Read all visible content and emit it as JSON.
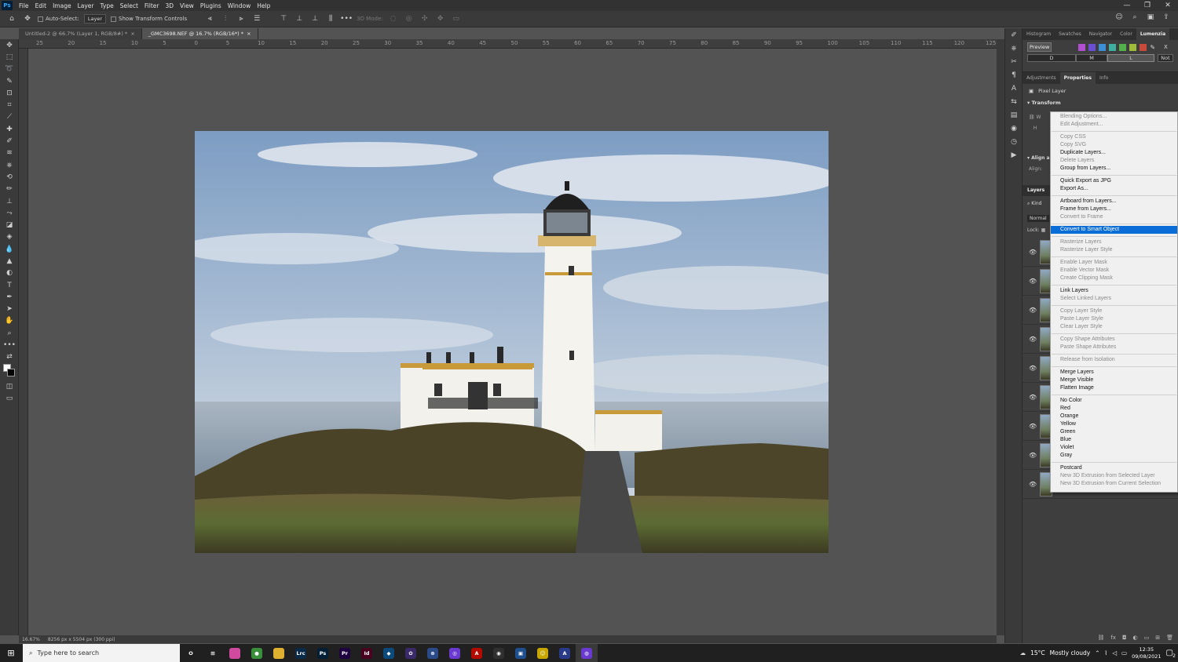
{
  "menubar": {
    "app_icon": "Ps",
    "items": [
      "File",
      "Edit",
      "Image",
      "Layer",
      "Type",
      "Select",
      "Filter",
      "3D",
      "View",
      "Plugins",
      "Window",
      "Help"
    ]
  },
  "options": {
    "auto_select_label": "Auto-Select:",
    "auto_select_value": "Layer",
    "show_transform_label": "Show Transform Controls",
    "mode_3d_label": "3D Mode:"
  },
  "tabs": [
    {
      "label": "Untitled-2 @ 66.7% (Layer 1, RGB/8#) *",
      "close": "×"
    },
    {
      "label": "_GMC3698.NEF @ 16.7% (RGB/16*) *",
      "close": "×"
    }
  ],
  "ruler_ticks": [
    "25",
    "20",
    "15",
    "10",
    "5",
    "0",
    "5",
    "10",
    "15",
    "20",
    "25",
    "30",
    "35",
    "40",
    "45",
    "50",
    "55",
    "60",
    "65",
    "70",
    "75",
    "80",
    "85",
    "90",
    "95",
    "100",
    "105",
    "110",
    "115",
    "120",
    "125"
  ],
  "status": {
    "zoom": "16.67%",
    "doc_info": "8256 px x 5504 px (300 ppi)"
  },
  "panel": {
    "top_tabs": [
      "Histogram",
      "Swatches",
      "Navigator",
      "Color",
      "Lumenzia"
    ],
    "top_active": "Lumenzia",
    "lumenzia": {
      "preview_label": "Preview",
      "x_label": "X",
      "zones": [
        "D",
        "M",
        "L"
      ],
      "not_label": "Not",
      "swatches": [
        "#b04fd2",
        "#6a4fd4",
        "#3b8fd6",
        "#3fb0a0",
        "#54b04a",
        "#9ebb3a",
        "#c84a3a"
      ]
    },
    "prop_tabs": [
      "Adjustments",
      "Properties",
      "Info"
    ],
    "prop_active": "Properties",
    "pixel_layer_label": "Pixel Layer",
    "transform_label": "Transform",
    "w_label": "W",
    "h_label": "H",
    "align_label": "Align a",
    "align_sub": "Align:",
    "layers_tab": "Layers",
    "kind_label": "Kind",
    "blend_label": "Normal",
    "lock_label": "Lock:",
    "layer_rows": 9
  },
  "context_menu": {
    "groups": [
      [
        {
          "label": "Blending Options...",
          "enabled": false
        },
        {
          "label": "Edit Adjustment...",
          "enabled": false
        }
      ],
      [
        {
          "label": "Copy CSS",
          "enabled": false
        },
        {
          "label": "Copy SVG",
          "enabled": false
        },
        {
          "label": "Duplicate Layers...",
          "enabled": true
        },
        {
          "label": "Delete Layers",
          "enabled": false
        },
        {
          "label": "Group from Layers...",
          "enabled": true
        }
      ],
      [
        {
          "label": "Quick Export as JPG",
          "enabled": true
        },
        {
          "label": "Export As...",
          "enabled": true
        }
      ],
      [
        {
          "label": "Artboard from Layers...",
          "enabled": true
        },
        {
          "label": "Frame from Layers...",
          "enabled": true
        },
        {
          "label": "Convert to Frame",
          "enabled": false
        }
      ],
      [
        {
          "label": "Convert to Smart Object",
          "enabled": true,
          "highlighted": true
        }
      ],
      [
        {
          "label": "Rasterize Layers",
          "enabled": false
        },
        {
          "label": "Rasterize Layer Style",
          "enabled": false
        }
      ],
      [
        {
          "label": "Enable Layer Mask",
          "enabled": false
        },
        {
          "label": "Enable Vector Mask",
          "enabled": false
        },
        {
          "label": "Create Clipping Mask",
          "enabled": false
        }
      ],
      [
        {
          "label": "Link Layers",
          "enabled": true
        },
        {
          "label": "Select Linked Layers",
          "enabled": false
        }
      ],
      [
        {
          "label": "Copy Layer Style",
          "enabled": false
        },
        {
          "label": "Paste Layer Style",
          "enabled": false
        },
        {
          "label": "Clear Layer Style",
          "enabled": false
        }
      ],
      [
        {
          "label": "Copy Shape Attributes",
          "enabled": false
        },
        {
          "label": "Paste Shape Attributes",
          "enabled": false
        }
      ],
      [
        {
          "label": "Release from Isolation",
          "enabled": false
        }
      ],
      [
        {
          "label": "Merge Layers",
          "enabled": true
        },
        {
          "label": "Merge Visible",
          "enabled": true
        },
        {
          "label": "Flatten Image",
          "enabled": true
        }
      ],
      [
        {
          "label": "No Color",
          "enabled": true
        },
        {
          "label": "Red",
          "enabled": true
        },
        {
          "label": "Orange",
          "enabled": true
        },
        {
          "label": "Yellow",
          "enabled": true
        },
        {
          "label": "Green",
          "enabled": true
        },
        {
          "label": "Blue",
          "enabled": true
        },
        {
          "label": "Violet",
          "enabled": true
        },
        {
          "label": "Gray",
          "enabled": true
        }
      ],
      [
        {
          "label": "Postcard",
          "enabled": true
        },
        {
          "label": "New 3D Extrusion from Selected Layer",
          "enabled": false
        },
        {
          "label": "New 3D Extrusion from Current Selection",
          "enabled": false
        }
      ]
    ]
  },
  "taskbar": {
    "search_placeholder": "Type here to search",
    "apps": [
      {
        "name": "task-view",
        "label": "O",
        "color": "transparent"
      },
      {
        "name": "widgets",
        "label": "⊞",
        "color": "transparent"
      },
      {
        "name": "photos",
        "label": "",
        "color": "#d04aa0"
      },
      {
        "name": "chrome",
        "label": "●",
        "color": "#3a8f3a"
      },
      {
        "name": "explorer",
        "label": "",
        "color": "#e0b030"
      },
      {
        "name": "lightroom-classic",
        "label": "Lrc",
        "color": "#0a2a4a"
      },
      {
        "name": "photoshop",
        "label": "Ps",
        "color": "#001e36"
      },
      {
        "name": "premiere",
        "label": "Pr",
        "color": "#1f0040"
      },
      {
        "name": "indesign",
        "label": "Id",
        "color": "#49021f"
      },
      {
        "name": "app-cube",
        "label": "◆",
        "color": "#0b4a7a"
      },
      {
        "name": "app-swirl",
        "label": "✿",
        "color": "#3a2a6a"
      },
      {
        "name": "app-globe",
        "label": "⊛",
        "color": "#2a4a8a"
      },
      {
        "name": "app-circle",
        "label": "◎",
        "color": "#6a3ad0"
      },
      {
        "name": "acrobat",
        "label": "A",
        "color": "#b30b00"
      },
      {
        "name": "obs",
        "label": "◉",
        "color": "#303030"
      },
      {
        "name": "app-frame",
        "label": "▣",
        "color": "#1f4f8f"
      },
      {
        "name": "app-yellow",
        "label": "☺",
        "color": "#c8a800"
      },
      {
        "name": "app-a",
        "label": "A",
        "color": "#2a3a8a"
      },
      {
        "name": "app-active",
        "label": "◍",
        "color": "#6a3ad0"
      }
    ],
    "weather_temp": "15°C",
    "weather_text": "Mostly cloudy",
    "time": "12:35",
    "date": "09/08/2021",
    "notif_count": "2"
  }
}
